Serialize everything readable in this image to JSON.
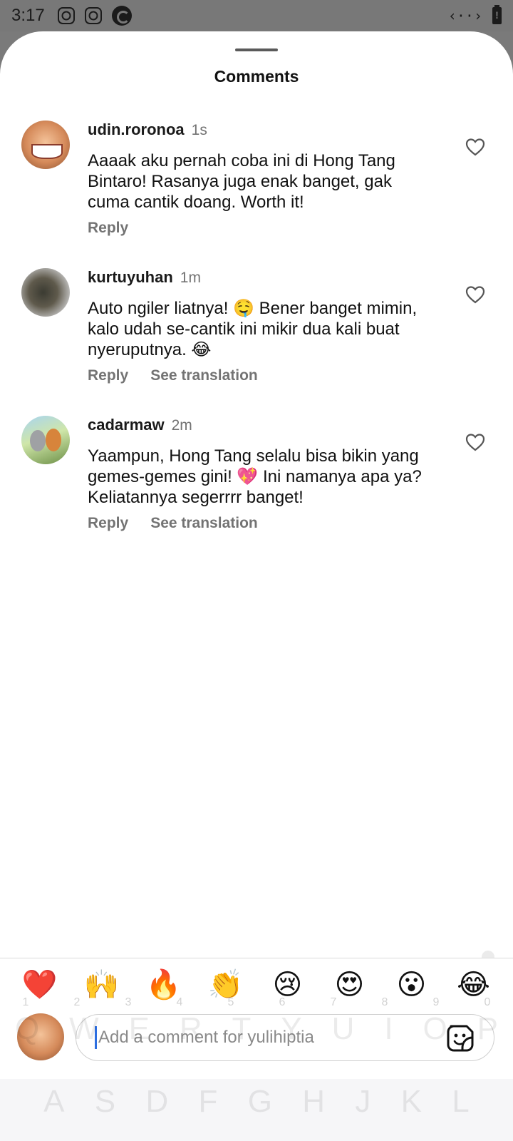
{
  "status_bar": {
    "time": "3:17",
    "left_icons": [
      "instagram-icon",
      "instagram-icon",
      "app-icon"
    ],
    "right_icons": [
      "code-icon",
      "battery-alert-icon"
    ],
    "code_glyph": "‹··›"
  },
  "sheet": {
    "title": "Comments"
  },
  "comments": [
    {
      "username": "udin.roronoa",
      "time": "1s",
      "text": "Aaaak aku pernah coba ini di Hong Tang Bintaro! Rasanya juga enak banget, gak cuma cantik doang. Worth it!",
      "actions": [
        "Reply"
      ]
    },
    {
      "username": "kurtuyuhan",
      "time": "1m",
      "text": "Auto ngiler liatnya! 🤤 Bener banget mimin, kalo udah se-cantik ini mikir dua kali buat nyeruputnya. 😂",
      "actions": [
        "Reply",
        "See translation"
      ]
    },
    {
      "username": "cadarmaw",
      "time": "2m",
      "text": "Yaampun, Hong Tang selalu bisa bikin yang gemes-gemes gini! 💖 Ini namanya apa ya? Keliatannya segerrrr banget!",
      "actions": [
        "Reply",
        "See translation"
      ]
    }
  ],
  "emoji_bar": [
    "❤️",
    "🙌",
    "🔥",
    "👏",
    "😢",
    "😍",
    "😮",
    "😂"
  ],
  "input": {
    "placeholder": "Add a comment for yulihiptia",
    "value": ""
  },
  "keyboard_ghost": {
    "numbers": [
      "1",
      "2",
      "3",
      "4",
      "5",
      "6",
      "7",
      "8",
      "9",
      "0"
    ],
    "row_top": [
      "Q",
      "W",
      "E",
      "R",
      "T",
      "Y",
      "U",
      "I",
      "O",
      "P"
    ],
    "row_mid": [
      "A",
      "S",
      "D",
      "F",
      "G",
      "H",
      "J",
      "K",
      "L"
    ]
  },
  "colors": {
    "accent_cursor": "#2d6ee0",
    "muted_text": "#737373",
    "status_bar_bg": "#787878"
  }
}
